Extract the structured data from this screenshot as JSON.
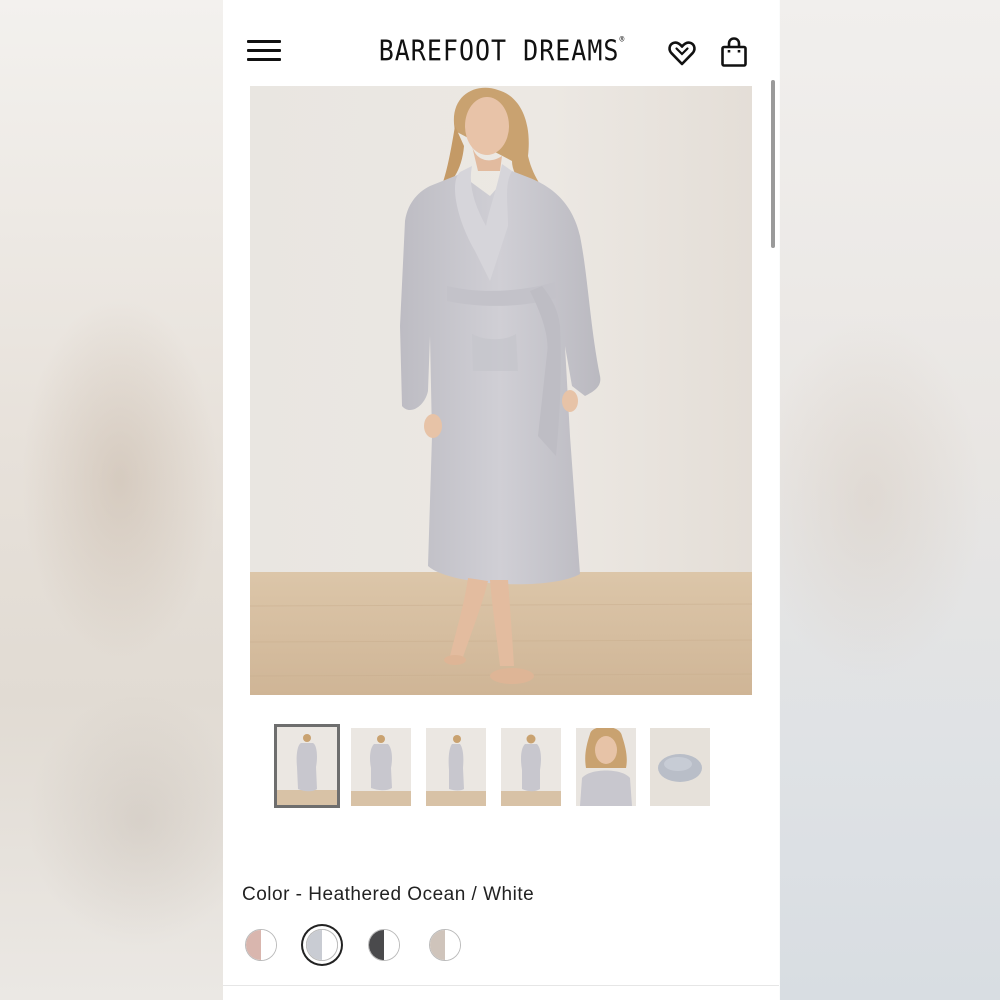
{
  "header": {
    "brand": "BAREFOOT DREAMS",
    "brand_mark": "®"
  },
  "product": {
    "color_label": "Color - Heathered Ocean / White",
    "thumbnails": [
      {
        "name": "front-full",
        "active": true
      },
      {
        "name": "front-walking"
      },
      {
        "name": "side"
      },
      {
        "name": "back"
      },
      {
        "name": "closeup-face"
      },
      {
        "name": "folded-robe"
      }
    ],
    "swatches": [
      {
        "name": "pink-white",
        "left": "#d9b6ae",
        "right": "#ffffff"
      },
      {
        "name": "heathered-ocean-white",
        "left": "#c9ccd3",
        "right": "#ffffff",
        "selected": true
      },
      {
        "name": "charcoal-white",
        "left": "#4a4a4c",
        "right": "#ffffff"
      },
      {
        "name": "beige-white",
        "left": "#cfc4bb",
        "right": "#ffffff"
      }
    ]
  },
  "colors": {
    "accent": "#111111",
    "background_panel": "#ffffff",
    "image_wall": "#e8e4df",
    "image_floor": "#d8c2a6",
    "robe": "#c9c8ce"
  }
}
